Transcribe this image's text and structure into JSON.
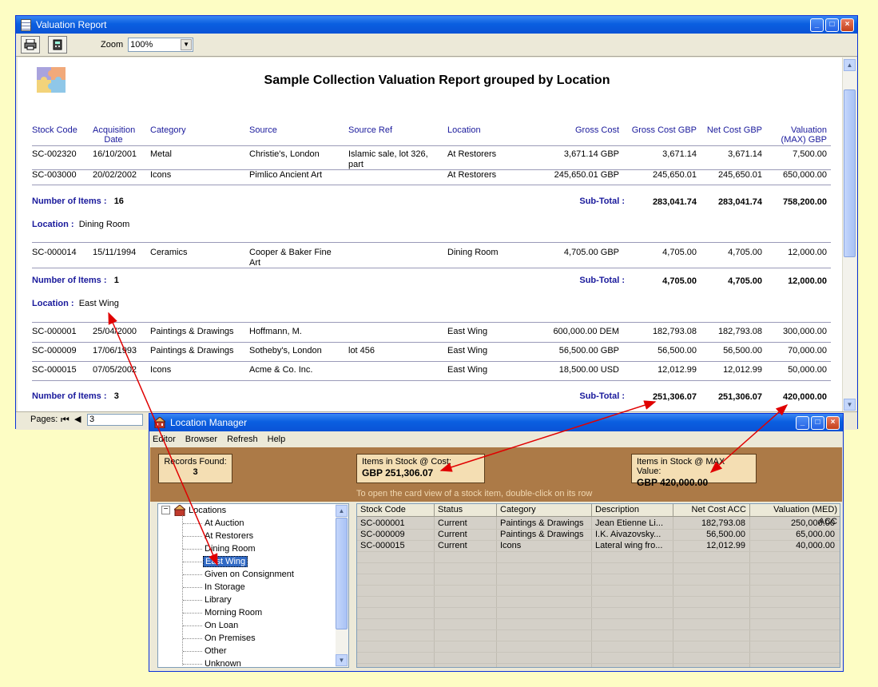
{
  "report_window": {
    "title": "Valuation Report",
    "zoom_label": "Zoom",
    "zoom_value": "100%",
    "report_title": "Sample Collection Valuation Report grouped by Location",
    "columns": [
      "Stock Code",
      "Acquisition Date",
      "Category",
      "Source",
      "Source Ref",
      "Location",
      "Gross Cost",
      "Gross Cost GBP",
      "Net Cost GBP",
      "Valuation (MAX) GBP"
    ],
    "col_acq_1": "Acquisition",
    "col_acq_2": "Date",
    "col_val_1": "Valuation",
    "col_val_2": "(MAX) GBP",
    "group1_rows": [
      {
        "code": "SC-002320",
        "date": "16/10/2001",
        "category": "Metal",
        "source": "Christie's, London",
        "ref1": "Islamic sale, lot 326,",
        "ref2": "part",
        "location": "At Restorers",
        "gross": "3,671.14 GBP",
        "gross_gbp": "3,671.14",
        "net": "3,671.14",
        "val": "7,500.00"
      },
      {
        "code": "SC-003000",
        "date": "20/02/2002",
        "category": "Icons",
        "source": "Pimlico Ancient Art",
        "ref1": "",
        "ref2": "",
        "location": "At Restorers",
        "gross": "245,650.01 GBP",
        "gross_gbp": "245,650.01",
        "net": "245,650.01",
        "val": "650,000.00"
      }
    ],
    "group1_summary": {
      "items_label": "Number of Items :",
      "count": "16",
      "subtotal_label": "Sub-Total :",
      "gross_gbp": "283,041.74",
      "net": "283,041.74",
      "val": "758,200.00"
    },
    "location_label": "Location :",
    "group2_location": "Dining Room",
    "group2_rows": [
      {
        "code": "SC-000014",
        "date": "15/11/1994",
        "category": "Ceramics",
        "source1": "Cooper & Baker Fine",
        "source2": "Art",
        "location": "Dining Room",
        "gross": "4,705.00 GBP",
        "gross_gbp": "4,705.00",
        "net": "4,705.00",
        "val": "12,000.00"
      }
    ],
    "group2_summary": {
      "items_label": "Number of Items :",
      "count": "1",
      "subtotal_label": "Sub-Total :",
      "gross_gbp": "4,705.00",
      "net": "4,705.00",
      "val": "12,000.00"
    },
    "group3_location": "East Wing",
    "group3_rows": [
      {
        "code": "SC-000001",
        "date": "25/04/2000",
        "category": "Paintings & Drawings",
        "source": "Hoffmann, M.",
        "ref": "",
        "location": "East Wing",
        "gross": "600,000.00 DEM",
        "gross_gbp": "182,793.08",
        "net": "182,793.08",
        "val": "300,000.00"
      },
      {
        "code": "SC-000009",
        "date": "17/06/1993",
        "category": "Paintings & Drawings",
        "source": "Sotheby's, London",
        "ref": "lot 456",
        "location": "East Wing",
        "gross": "56,500.00 GBP",
        "gross_gbp": "56,500.00",
        "net": "56,500.00",
        "val": "70,000.00"
      },
      {
        "code": "SC-000015",
        "date": "07/05/2002",
        "category": "Icons",
        "source": "Acme & Co. Inc.",
        "ref": "",
        "location": "East Wing",
        "gross": "18,500.00 USD",
        "gross_gbp": "12,012.99",
        "net": "12,012.99",
        "val": "50,000.00"
      }
    ],
    "group3_summary": {
      "items_label": "Number of Items :",
      "count": "3",
      "subtotal_label": "Sub-Total :",
      "gross_gbp": "251,306.07",
      "net": "251,306.07",
      "val": "420,000.00"
    },
    "pages_label": "Pages:",
    "page_value": "3"
  },
  "location_manager": {
    "title": "Location Manager",
    "menu": [
      "Editor",
      "Browser",
      "Refresh",
      "Help"
    ],
    "records_label": "Records Found:",
    "records_value": "3",
    "cost_label": "Items in Stock @ Cost:",
    "cost_value": "GBP  251,306.07",
    "max_label": "Items in Stock @ MAX Value:",
    "max_value": "GBP  420,000.00",
    "hint": "To open the card view of a stock item, double-click on its row",
    "tree_root": "Locations",
    "tree_items": [
      "At Auction",
      "At Restorers",
      "Dining Room",
      "East Wing",
      "Given on Consignment",
      "In Storage",
      "Library",
      "Morning Room",
      "On Loan",
      "On Premises",
      "Other",
      "Unknown"
    ],
    "tree_selected": "East Wing",
    "grid_columns": [
      "Stock Code",
      "Status",
      "Category",
      "Description",
      "Net Cost ACC",
      "Valuation (MED) ACC"
    ],
    "grid_rows": [
      [
        "SC-000001",
        "Current",
        "Paintings & Drawings",
        "Jean Etienne Li...",
        "182,793.08",
        "250,000.00"
      ],
      [
        "SC-000009",
        "Current",
        "Paintings & Drawings",
        "I.K. Aivazovsky...",
        "56,500.00",
        "65,000.00"
      ],
      [
        "SC-000015",
        "Current",
        "Icons",
        "Lateral wing fro...",
        "12,012.99",
        "40,000.00"
      ]
    ]
  },
  "colors": {
    "background": "#fdfdc4",
    "arrow": "#e00000",
    "header_text": "#1a1a9c",
    "panel_brown": "#ac7a47"
  }
}
